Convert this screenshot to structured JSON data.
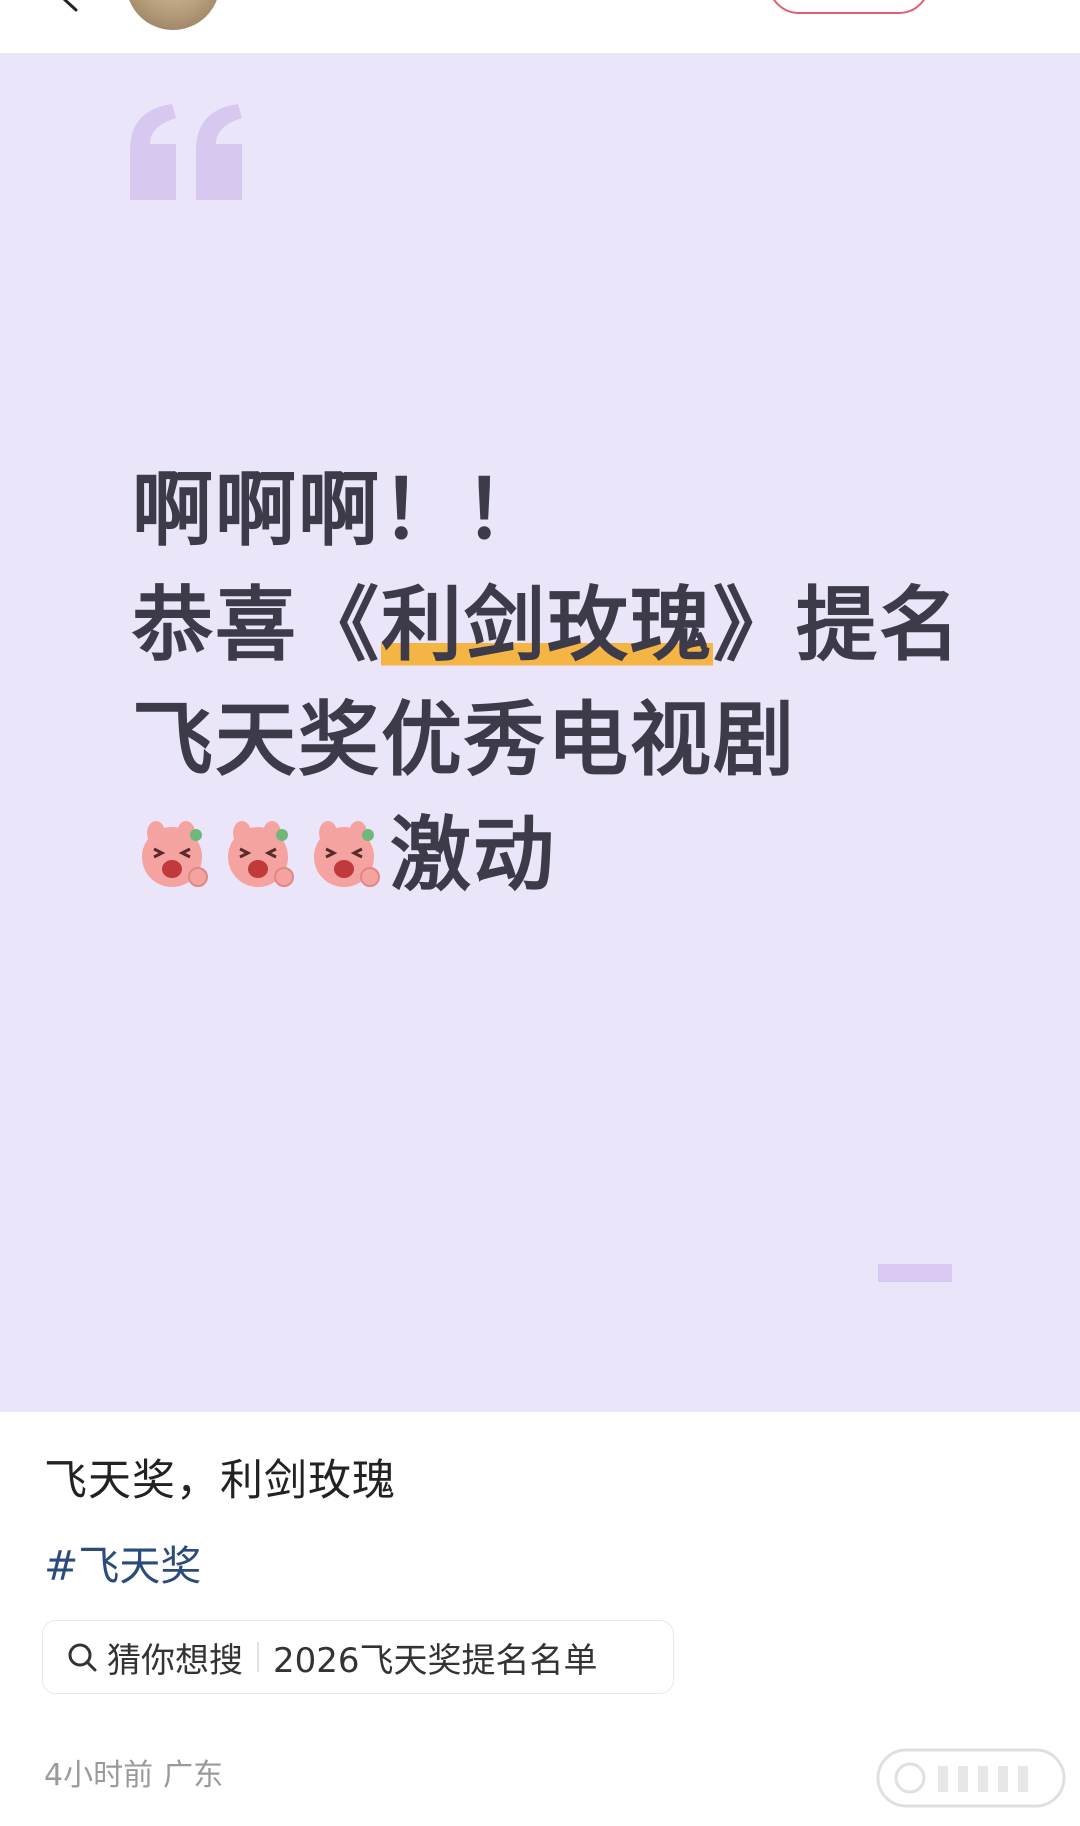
{
  "header": {
    "follow_label": ""
  },
  "card": {
    "lines": [
      "啊啊啊！！",
      "恭喜《",
      "利剑玫瑰",
      "》提名",
      "飞天奖优秀电视剧",
      "激动"
    ],
    "emoji_name": "laughing-pig-emoji",
    "emoji_count": 3,
    "highlight_color": "#f4b545",
    "background": "#ebe5fa"
  },
  "post": {
    "title": "飞天奖，利剑玫瑰",
    "hashtag": "#飞天奖",
    "search": {
      "label": "猜你想搜",
      "query": "2026飞天奖提名名单"
    },
    "time": "4小时前",
    "location": "广东"
  }
}
